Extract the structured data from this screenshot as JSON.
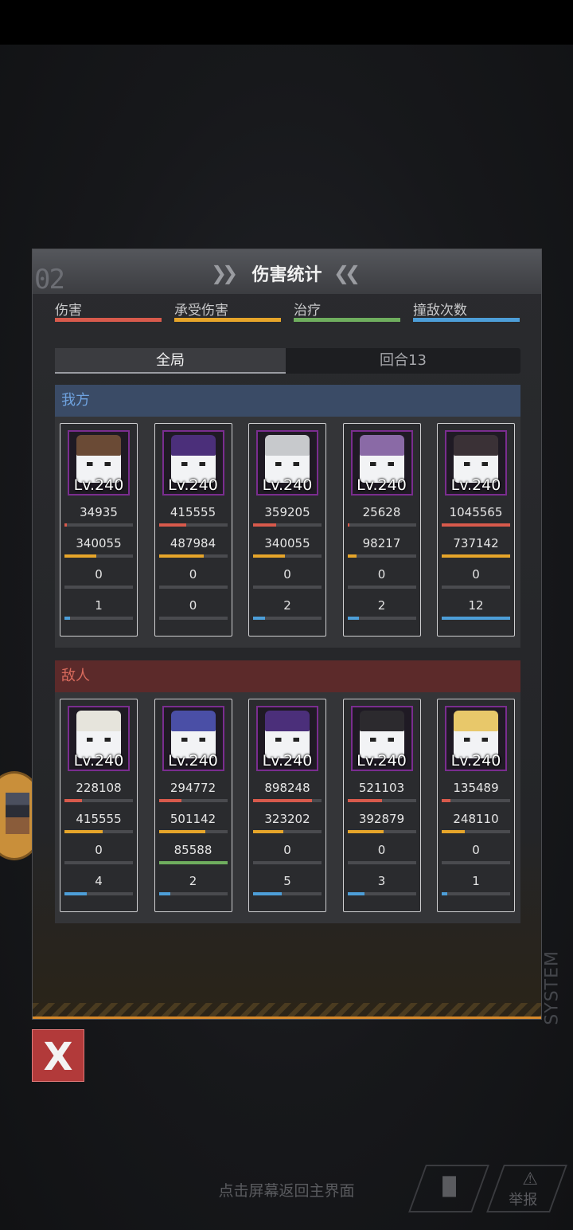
{
  "panel": {
    "number": "02",
    "title": "伤害统计",
    "system_label": "SYSTEM"
  },
  "legend": [
    {
      "label": "伤害",
      "color": "#d85a4c"
    },
    {
      "label": "承受伤害",
      "color": "#e6a52a"
    },
    {
      "label": "治疗",
      "color": "#6fae5e"
    },
    {
      "label": "撞敌次数",
      "color": "#4d9ed8"
    }
  ],
  "tabs": [
    {
      "label": "全局",
      "active": true
    },
    {
      "label": "回合13",
      "active": false
    }
  ],
  "sections": [
    {
      "title": "我方",
      "head_color": "#3a4b66",
      "title_color": "#6fa3e0",
      "units": [
        {
          "level": "Lv.240",
          "portrait": "brown-hair-hero-portrait",
          "hair": "#6a4a35",
          "stats": [
            {
              "value": "34935",
              "ratio": 0.03
            },
            {
              "value": "340055",
              "ratio": 0.46
            },
            {
              "value": "0",
              "ratio": 0
            },
            {
              "value": "1",
              "ratio": 0.08
            }
          ]
        },
        {
          "level": "Lv.240",
          "portrait": "purple-dragon-portrait",
          "hair": "#4b2f7a",
          "stats": [
            {
              "value": "415555",
              "ratio": 0.4
            },
            {
              "value": "487984",
              "ratio": 0.66
            },
            {
              "value": "0",
              "ratio": 0
            },
            {
              "value": "0",
              "ratio": 0
            }
          ]
        },
        {
          "level": "Lv.240",
          "portrait": "silver-hair-girl-portrait",
          "hair": "#c7c9cc",
          "stats": [
            {
              "value": "359205",
              "ratio": 0.34
            },
            {
              "value": "340055",
              "ratio": 0.46
            },
            {
              "value": "0",
              "ratio": 0
            },
            {
              "value": "2",
              "ratio": 0.17
            }
          ]
        },
        {
          "level": "Lv.240",
          "portrait": "purple-hair-girl-portrait",
          "hair": "#8a6aa6",
          "stats": [
            {
              "value": "25628",
              "ratio": 0.03
            },
            {
              "value": "98217",
              "ratio": 0.13
            },
            {
              "value": "0",
              "ratio": 0
            },
            {
              "value": "2",
              "ratio": 0.17
            }
          ]
        },
        {
          "level": "Lv.240",
          "portrait": "dark-hair-staff-girl-portrait",
          "hair": "#3a3136",
          "stats": [
            {
              "value": "1045565",
              "ratio": 1.0
            },
            {
              "value": "737142",
              "ratio": 1.0
            },
            {
              "value": "0",
              "ratio": 0
            },
            {
              "value": "12",
              "ratio": 1.0
            }
          ]
        }
      ]
    },
    {
      "title": "敌人",
      "head_color": "#5c2a2a",
      "title_color": "#d86a5c",
      "units": [
        {
          "level": "Lv.240",
          "portrait": "white-beard-elder-portrait",
          "hair": "#e6e4dc",
          "stats": [
            {
              "value": "228108",
              "ratio": 0.25
            },
            {
              "value": "415555",
              "ratio": 0.56
            },
            {
              "value": "0",
              "ratio": 0
            },
            {
              "value": "4",
              "ratio": 0.33
            }
          ]
        },
        {
          "level": "Lv.240",
          "portrait": "blue-hair-sunglasses-portrait",
          "hair": "#4a4fa6",
          "stats": [
            {
              "value": "294772",
              "ratio": 0.33
            },
            {
              "value": "501142",
              "ratio": 0.68
            },
            {
              "value": "85588",
              "ratio": 1.0
            },
            {
              "value": "2",
              "ratio": 0.17
            }
          ]
        },
        {
          "level": "Lv.240",
          "portrait": "purple-dragon-portrait",
          "hair": "#4b2f7a",
          "stats": [
            {
              "value": "898248",
              "ratio": 0.86
            },
            {
              "value": "323202",
              "ratio": 0.44
            },
            {
              "value": "0",
              "ratio": 0
            },
            {
              "value": "5",
              "ratio": 0.42
            }
          ]
        },
        {
          "level": "Lv.240",
          "portrait": "horned-black-hair-girl-portrait",
          "hair": "#2c2a2e",
          "stats": [
            {
              "value": "521103",
              "ratio": 0.5
            },
            {
              "value": "392879",
              "ratio": 0.53
            },
            {
              "value": "0",
              "ratio": 0
            },
            {
              "value": "3",
              "ratio": 0.25
            }
          ]
        },
        {
          "level": "Lv.240",
          "portrait": "blonde-girl-portrait",
          "hair": "#e8c86a",
          "stats": [
            {
              "value": "135489",
              "ratio": 0.13
            },
            {
              "value": "248110",
              "ratio": 0.34
            },
            {
              "value": "0",
              "ratio": 0
            },
            {
              "value": "1",
              "ratio": 0.08
            }
          ]
        }
      ]
    }
  ],
  "close_button": "X",
  "hint": "点击屏幕返回主界面",
  "corner_buttons": [
    {
      "icon": "bar-chart-icon",
      "label": ""
    },
    {
      "icon": "warning-icon",
      "label": "举报"
    }
  ]
}
